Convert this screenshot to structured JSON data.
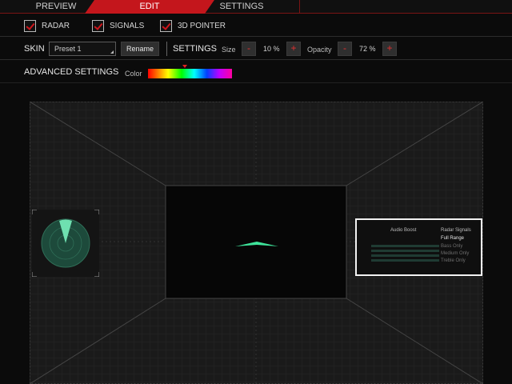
{
  "tabs": [
    {
      "label": "PREVIEW",
      "active": false
    },
    {
      "label": "EDIT",
      "active": true
    },
    {
      "label": "SETTINGS",
      "active": false
    }
  ],
  "toggles": [
    {
      "label": "RADAR",
      "checked": true
    },
    {
      "label": "SIGNALS",
      "checked": true
    },
    {
      "label": "3D POINTER",
      "checked": true
    }
  ],
  "skin": {
    "label": "SKIN",
    "preset_value": "Preset 1",
    "rename_label": "Rename"
  },
  "settings": {
    "label": "SETTINGS",
    "size_label": "Size",
    "size_value": "10 %",
    "opacity_label": "Opacity",
    "opacity_value": "72 %",
    "minus": "-",
    "plus": "+"
  },
  "advanced": {
    "label": "ADVANCED SETTINGS",
    "color_label": "Color"
  },
  "overlay": {
    "audio_boost_label": "Audio Boost",
    "radar_signals_label": "Radar Signals",
    "options": [
      "Full Range",
      "Bass Only",
      "Medium Only",
      "Treble Only"
    ],
    "selected": "Full Range"
  },
  "colors": {
    "accent": "#c4161c",
    "radar_green": "#2fae7e",
    "pointer_green": "#3ee39a"
  }
}
